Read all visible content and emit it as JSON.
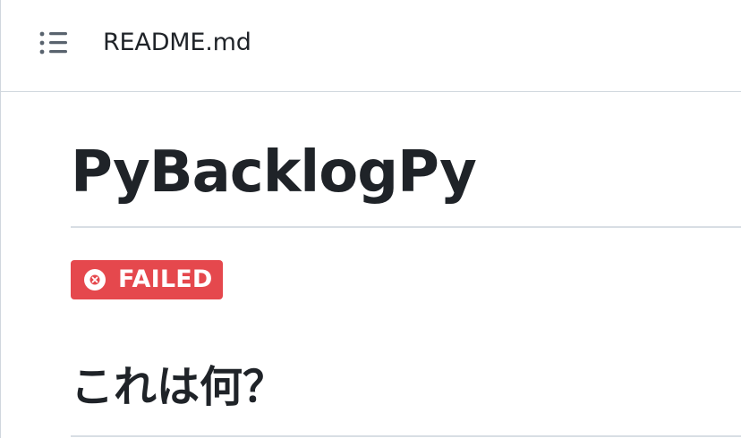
{
  "header": {
    "toc_icon": "list-unordered-icon",
    "file_name": "README.md"
  },
  "readme": {
    "title": "PyBacklogPy",
    "badge": {
      "icon": "x-circle-icon",
      "label": "FAILED",
      "color": "#e5484d"
    },
    "section_heading": "これは何？"
  },
  "colors": {
    "text": "#1f2328",
    "border": "#d0d7de",
    "badge_bg": "#e5484d"
  }
}
